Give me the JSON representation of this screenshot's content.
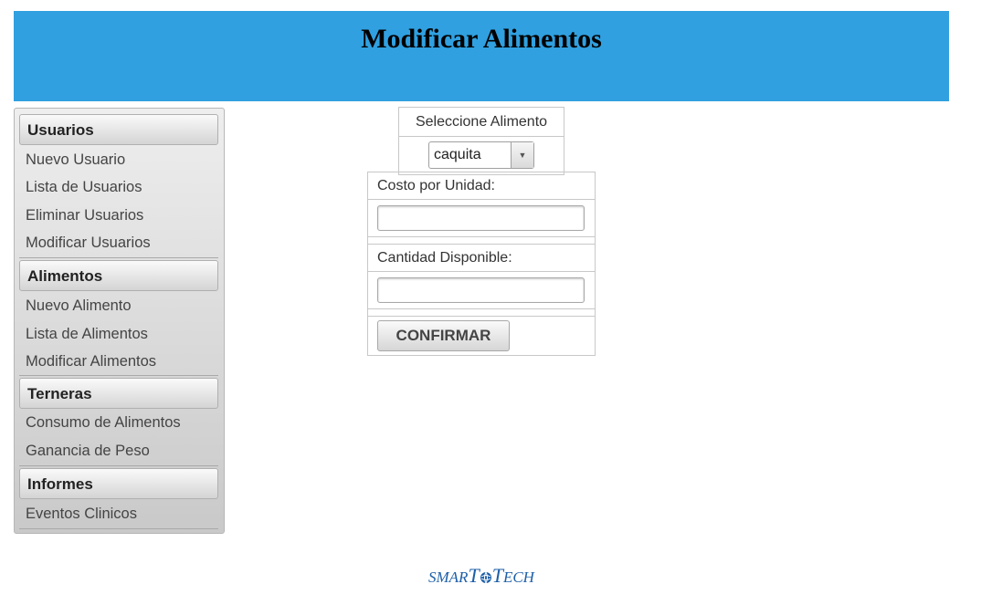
{
  "header": {
    "title": "Modificar Alimentos"
  },
  "sidebar": {
    "sections": [
      {
        "label": "Usuarios",
        "items": [
          "Nuevo Usuario",
          "Lista de Usuarios",
          "Eliminar Usuarios",
          "Modificar Usuarios"
        ]
      },
      {
        "label": "Alimentos",
        "items": [
          "Nuevo Alimento",
          "Lista de Alimentos",
          "Modificar Alimentos"
        ]
      },
      {
        "label": "Terneras",
        "items": [
          "Consumo de Alimentos",
          "Ganancia de Peso"
        ]
      },
      {
        "label": "Informes",
        "items": [
          "Eventos Clinicos"
        ]
      }
    ]
  },
  "select_food": {
    "label": "Seleccione Alimento",
    "value": "caquita"
  },
  "form": {
    "cost_label": "Costo por Unidad:",
    "cost_value": "",
    "qty_label": "Cantidad Disponible:",
    "qty_value": "",
    "confirm_label": "CONFIRMAR"
  },
  "footer": {
    "logo_part1": "SMAR",
    "logo_t1": "T",
    "logo_t2": "T",
    "logo_part2": "ECH"
  },
  "colors": {
    "header_bg": "#30a0e0",
    "logo": "#1d5fa8"
  }
}
